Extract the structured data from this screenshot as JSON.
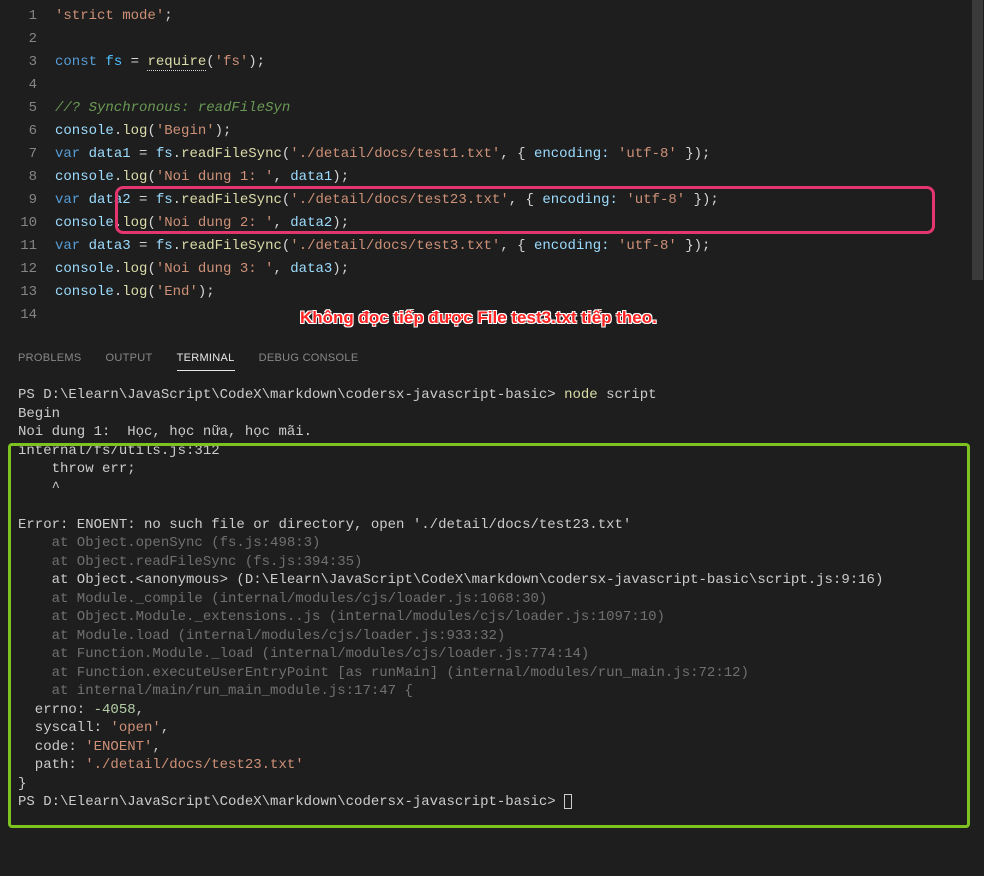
{
  "editor": {
    "lines": [
      {
        "num": "1"
      },
      {
        "num": "2"
      },
      {
        "num": "3"
      },
      {
        "num": "4"
      },
      {
        "num": "5"
      },
      {
        "num": "6"
      },
      {
        "num": "7"
      },
      {
        "num": "8"
      },
      {
        "num": "9"
      },
      {
        "num": "10"
      },
      {
        "num": "11"
      },
      {
        "num": "12"
      },
      {
        "num": "13"
      },
      {
        "num": "14"
      }
    ],
    "code": {
      "l1_str": "'strict mode'",
      "l1_semi": ";",
      "l3_const": "const",
      "l3_fs": " fs ",
      "l3_eq": "= ",
      "l3_req": "require",
      "l3_p1": "(",
      "l3_str": "'fs'",
      "l3_p2": ");",
      "l5_comment": "//? Synchronous: readFileSyn",
      "l6_console": "console",
      "l6_dot": ".",
      "l6_log": "log",
      "l6_p1": "(",
      "l6_str": "'Begin'",
      "l6_p2": ");",
      "l7_var": "var",
      "l7_d1": " data1 ",
      "l7_eq": "= ",
      "l7_fs": "fs",
      "l7_dot": ".",
      "l7_rfs": "readFileSync",
      "l7_p1": "(",
      "l7_str": "'./detail/docs/test1.txt'",
      "l7_c": ", { ",
      "l7_enc": "encoding:",
      "l7_sp": " ",
      "l7_utf": "'utf-8'",
      "l7_p2": " });",
      "l8_console": "console",
      "l8_log": "log",
      "l8_p1": "(",
      "l8_str": "'Noi dung 1: '",
      "l8_c": ", ",
      "l8_d": "data1",
      "l8_p2": ");",
      "l9_var": "var",
      "l9_d2": " data2 ",
      "l9_str": "'./detail/docs/test23.txt'",
      "l10_str": "'Noi dung 2: '",
      "l10_d": "data2",
      "l11_var": "var",
      "l11_d3": " data3 ",
      "l11_str": "'./detail/docs/test3.txt'",
      "l12_str": "'Noi dung 3: '",
      "l12_d": "data3",
      "l13_str": "'End'"
    },
    "annotation": "Không đọc tiếp được File test3.txt tiếp theo."
  },
  "panel": {
    "tabs": {
      "problems": "PROBLEMS",
      "output": "OUTPUT",
      "terminal": "TERMINAL",
      "debug": "DEBUG CONSOLE"
    }
  },
  "terminal": {
    "prompt1_a": "PS D:\\Elearn\\JavaScript\\CodeX\\markdown\\codersx-javascript-basic> ",
    "prompt1_cmd": "node",
    "prompt1_arg": " script",
    "out1": "Begin",
    "out2": "Noi dung 1:  Học, học nữa, học mãi.",
    "err1": "internal/fs/utils.js:312",
    "err2": "    throw err;",
    "err3": "    ^",
    "err4": "Error: ENOENT: no such file or directory, open './detail/docs/test23.txt'",
    "st1": "    at Object.openSync (fs.js:498:3)",
    "st2": "    at Object.readFileSync (fs.js:394:35)",
    "st3": "    at Object.<anonymous> (D:\\Elearn\\JavaScript\\CodeX\\markdown\\codersx-javascript-basic\\script.js:9:16)",
    "st4": "    at Module._compile (internal/modules/cjs/loader.js:1068:30)",
    "st5": "    at Object.Module._extensions..js (internal/modules/cjs/loader.js:1097:10)",
    "st6": "    at Module.load (internal/modules/cjs/loader.js:933:32)",
    "st7": "    at Function.Module._load (internal/modules/cjs/loader.js:774:14)",
    "st8": "    at Function.executeUserEntryPoint [as runMain] (internal/modules/run_main.js:72:12)",
    "st9": "    at internal/main/run_main_module.js:17:47 {",
    "errno_k": "  errno: ",
    "errno_v": "-4058",
    "errno_c": ",",
    "syscall_k": "  syscall: ",
    "syscall_v": "'open'",
    "code_k": "  code: ",
    "code_v": "'ENOENT'",
    "path_k": "  path: ",
    "path_v": "'./detail/docs/test23.txt'",
    "close": "}",
    "prompt2": "PS D:\\Elearn\\JavaScript\\CodeX\\markdown\\codersx-javascript-basic> "
  }
}
